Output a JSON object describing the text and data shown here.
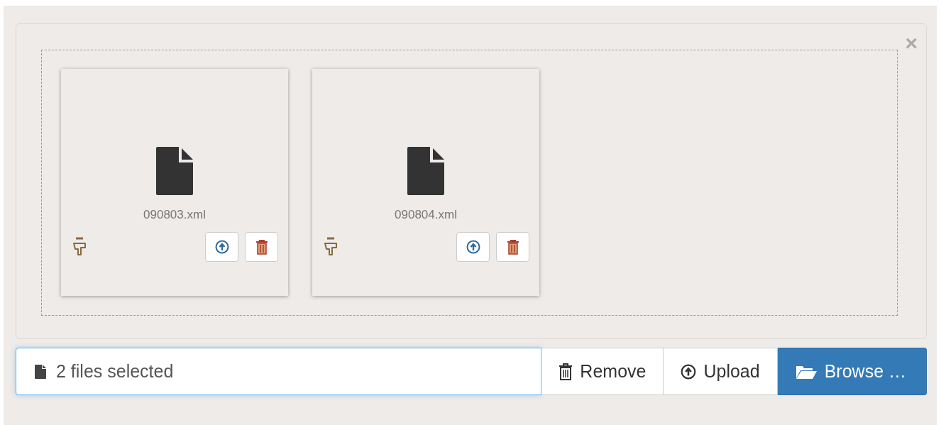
{
  "close_label": "×",
  "files": [
    {
      "name": "090803.xml"
    },
    {
      "name": "090804.xml"
    }
  ],
  "caption": "2 files selected",
  "buttons": [
    {
      "kind": "remove",
      "label": "Remove"
    },
    {
      "kind": "upload",
      "label": "Upload"
    },
    {
      "kind": "browse",
      "label": "Browse …"
    }
  ]
}
